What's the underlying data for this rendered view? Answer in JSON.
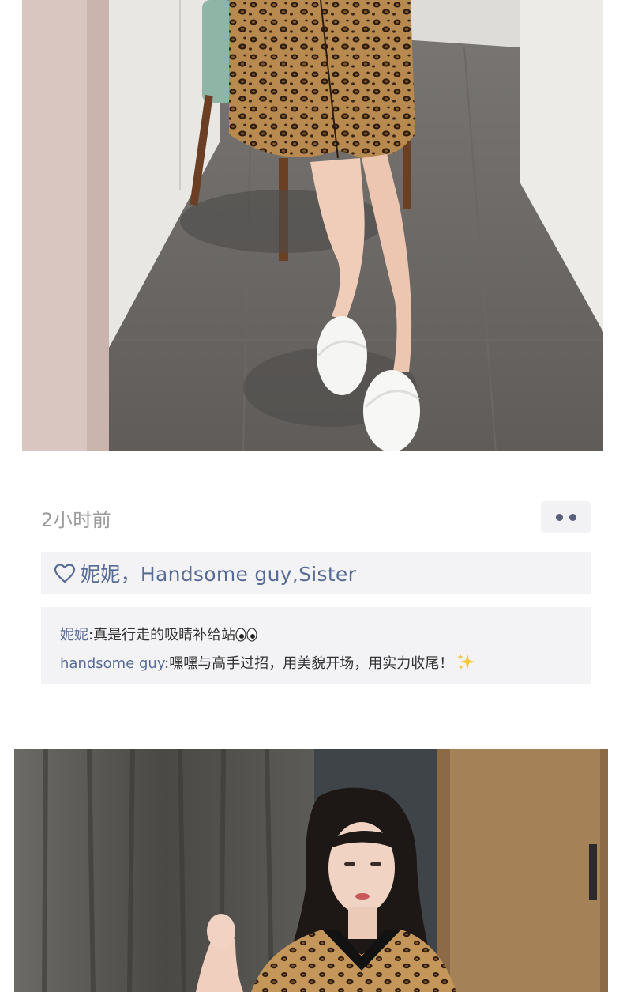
{
  "moment": {
    "time": "2小时前",
    "likes": "妮妮，Handsome guy,Sister",
    "comments": [
      {
        "author": "妮妮",
        "separator": ":",
        "text": "真是行走的吸睛补给站"
      },
      {
        "author": "handsome guy",
        "separator": ":",
        "text": "嘿嘿与高手过招，用美貌开场，用实力收尾！"
      }
    ]
  },
  "icons": {
    "more": "more-dots-icon",
    "like": "heart-outline-icon",
    "eyes": "eyes-emoji-icon",
    "sparkles": "sparkles-emoji-icon"
  },
  "colors": {
    "link_blue": "#576b95",
    "box_bg": "#f3f3f5",
    "time_gray": "#9a9a9a"
  }
}
